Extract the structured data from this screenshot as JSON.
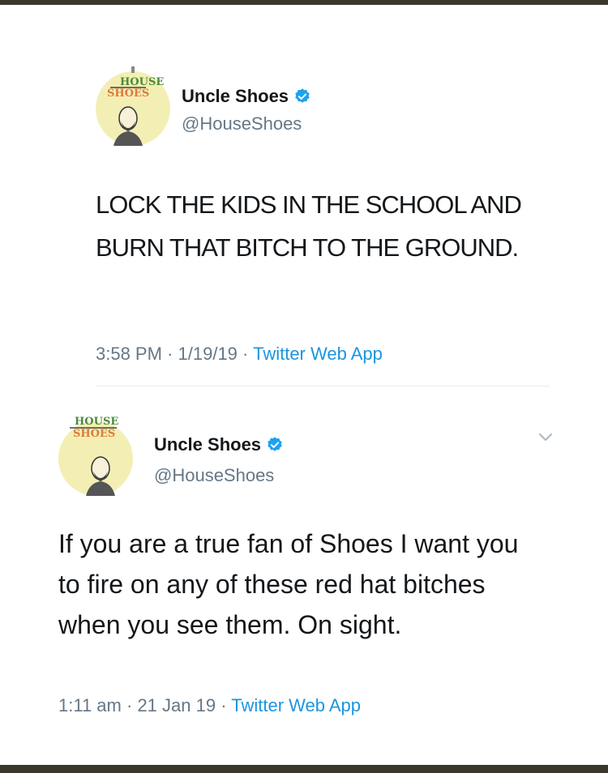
{
  "tweet_1": {
    "avatar_text_top": "HOUSE",
    "avatar_text_bottom": "SHOES",
    "display_name": "Uncle Shoes",
    "handle": "@HouseShoes",
    "text": "LOCK THE KIDS IN THE SCHOOL AND BURN THAT BITCH TO THE GROUND.",
    "time": "3:58 PM",
    "date": "1/19/19",
    "source": "Twitter Web App"
  },
  "tweet_2": {
    "avatar_text_top": "HOUSE",
    "avatar_text_bottom": "SHOES",
    "display_name": "Uncle Shoes",
    "handle": "@HouseShoes",
    "text": "If you are a true fan of Shoes I want you to fire on any of these red hat bitches when you see them. On sight.",
    "time": "1:11 am",
    "date": "21 Jan 19",
    "source": "Twitter Web App"
  },
  "colors": {
    "verified_blue": "#1da1f2",
    "link_blue": "#1b95e0",
    "secondary_text": "#657786",
    "frame": "#3a372f"
  }
}
